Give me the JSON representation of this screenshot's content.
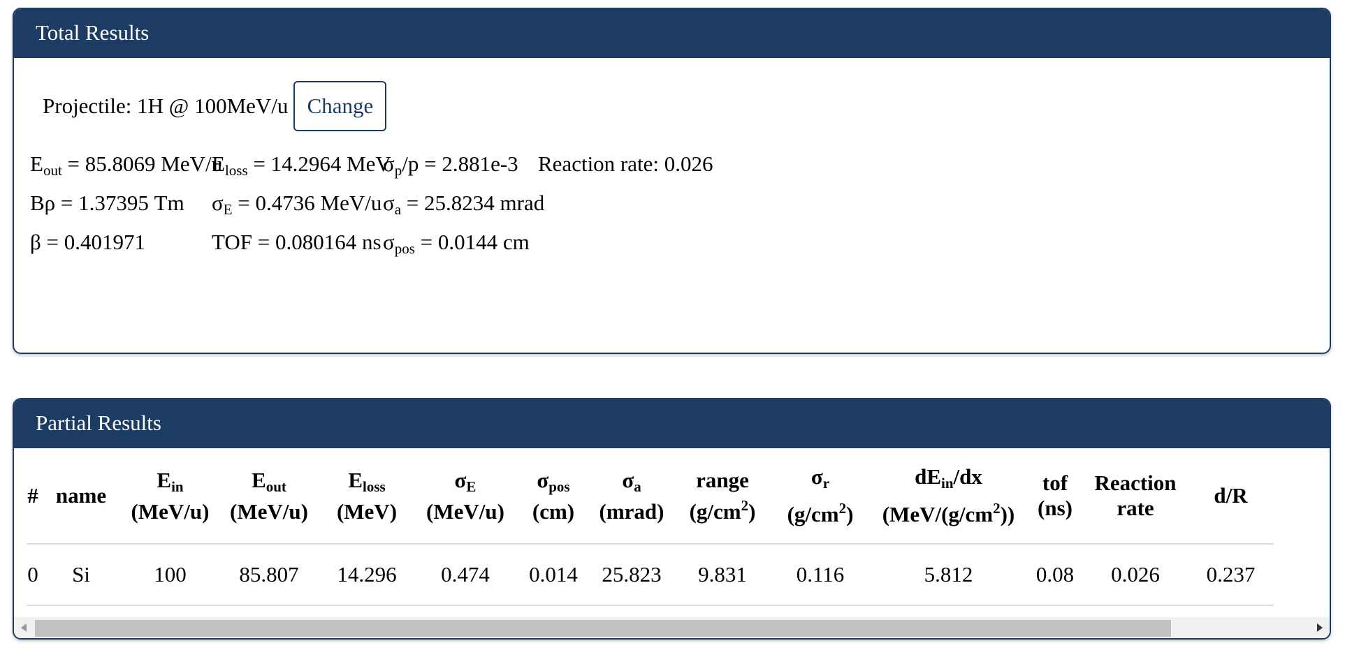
{
  "total": {
    "title": "Total Results",
    "projectile_label": "Projectile: 1H @ 100MeV/u",
    "change_label": "Change",
    "results": {
      "e_out_sym": "E",
      "e_out_sub": "out",
      "e_out_val": " = 85.8069 MeV/u",
      "e_loss_sym": "E",
      "e_loss_sub": "loss",
      "e_loss_val": " = 14.2964 MeV",
      "sigma_p_sym": "σ",
      "sigma_p_sub": "p",
      "sigma_p_val": "/p = 2.881e-3",
      "reaction_rate": "Reaction rate: 0.026",
      "brho": "Bρ = 1.37395 Tm",
      "sigma_e_sym": "σ",
      "sigma_e_sub": "E",
      "sigma_e_val": " = 0.4736 MeV/u",
      "sigma_a_sym": "σ",
      "sigma_a_sub": "a",
      "sigma_a_val": " = 25.8234 mrad",
      "beta": "β = 0.401971",
      "tof": "TOF = 0.080164 ns",
      "sigma_pos_sym": "σ",
      "sigma_pos_sub": "pos",
      "sigma_pos_val": " = 0.0144 cm"
    }
  },
  "partial": {
    "title": "Partial Results",
    "headers": {
      "num": "#",
      "name": "name",
      "e_in_sym": "E",
      "e_in_sub": "in",
      "e_in_unit": "(MeV/u)",
      "e_out_sym": "E",
      "e_out_sub": "out",
      "e_out_unit": "(MeV/u)",
      "e_loss_sym": "E",
      "e_loss_sub": "loss",
      "e_loss_unit": "(MeV)",
      "sigma_e_sym": "σ",
      "sigma_e_sub": "E",
      "sigma_e_unit": "(MeV/u)",
      "sigma_pos_sym": "σ",
      "sigma_pos_sub": "pos",
      "sigma_pos_unit": "(cm)",
      "sigma_a_sym": "σ",
      "sigma_a_sub": "a",
      "sigma_a_unit": "(mrad)",
      "range": "range",
      "range_unit_a": "(g/cm",
      "range_unit_sup": "2",
      "range_unit_b": ")",
      "sigma_r_sym": "σ",
      "sigma_r_sub": "r",
      "sigma_r_unit_a": "(g/cm",
      "sigma_r_unit_sup": "2",
      "sigma_r_unit_b": ")",
      "de_sym": "dE",
      "de_sub": "in",
      "de_tail": "/dx",
      "de_unit_a": "(MeV/(g/cm",
      "de_unit_sup": "2",
      "de_unit_b": "))",
      "tof": "tof",
      "tof_unit": "(ns)",
      "reaction_a": "Reaction",
      "reaction_b": "rate",
      "dr": "d/R"
    },
    "rows": [
      [
        "0",
        "Si",
        "100",
        "85.807",
        "14.296",
        "0.474",
        "0.014",
        "25.823",
        "9.831",
        "0.116",
        "5.812",
        "0.08",
        "0.026",
        "0.237"
      ]
    ]
  }
}
